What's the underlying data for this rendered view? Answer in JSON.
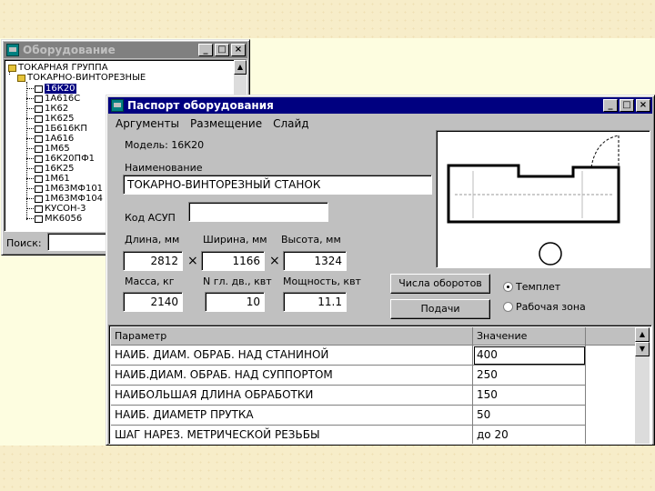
{
  "tree_window": {
    "title": "Оборудование",
    "root": "ТОКАРНАЯ ГРУППА",
    "group": "ТОКАРНО-ВИНТОРЕЗНЫЕ",
    "items": [
      "16К20",
      "1А616С",
      "1К62",
      "1К625",
      "1Б616КП",
      "1А616",
      "1М65",
      "16К20ПФ1",
      "16К25",
      "1М61",
      "1М63МФ101",
      "1М63МФ104",
      "КУСОН-3",
      "МК6056"
    ],
    "selected_index": 0,
    "search_label": "Поиск:",
    "search_value": ""
  },
  "passport_window": {
    "title": "Паспорт оборудования",
    "menu": [
      "Аргументы",
      "Размещение",
      "Слайд"
    ],
    "model_label": "Модель: 16К20",
    "name_label": "Наименование",
    "name_value": "ТОКАРНО-ВИНТОРЕЗНЫЙ СТАНОК",
    "asup_label": "Код АСУП",
    "asup_value": "",
    "length_label": "Длина, мм",
    "length_value": "2812",
    "width_label": "Ширина, мм",
    "width_value": "1166",
    "height_label": "Высота, мм",
    "height_value": "1324",
    "times_symbol": "×",
    "mass_label": "Масса, кг",
    "mass_value": "2140",
    "motors_label": "N гл. дв., квт",
    "motors_value": "10",
    "power_label": "Мощность, квт",
    "power_value": "11.1",
    "btn_speeds": "Числа оборотов",
    "btn_feeds": "Подачи",
    "radio_template": "Темплет",
    "radio_workzone": "Рабочая зона",
    "radio_selected": "template",
    "table": {
      "headers": [
        "Параметр",
        "Значение"
      ],
      "rows": [
        [
          "НАИБ. ДИАМ. ОБРАБ. НАД СТАНИНОЙ",
          "400"
        ],
        [
          "НАИБ.ДИАМ. ОБРАБ. НАД СУППОРТОМ",
          "250"
        ],
        [
          "НАИБОЛЬШАЯ ДЛИНА ОБРАБОТКИ",
          "150"
        ],
        [
          "НАИБ. ДИАМЕТР ПРУТКА",
          "50"
        ],
        [
          "ШАГ НАРЕЗ. МЕТРИЧЕСКОЙ РЕЗЬБЫ",
          "до 20"
        ]
      ]
    }
  },
  "colors": {
    "titlebar_active": "#000080",
    "titlebar_inactive": "#808080",
    "window_face": "#c0c0c0",
    "slide_bg": "#fdfde0"
  },
  "icons": [
    "app-icon",
    "folder-icon",
    "document-icon",
    "minimize-icon",
    "maximize-icon",
    "close-icon",
    "scroll-up-icon",
    "scroll-down-icon"
  ]
}
